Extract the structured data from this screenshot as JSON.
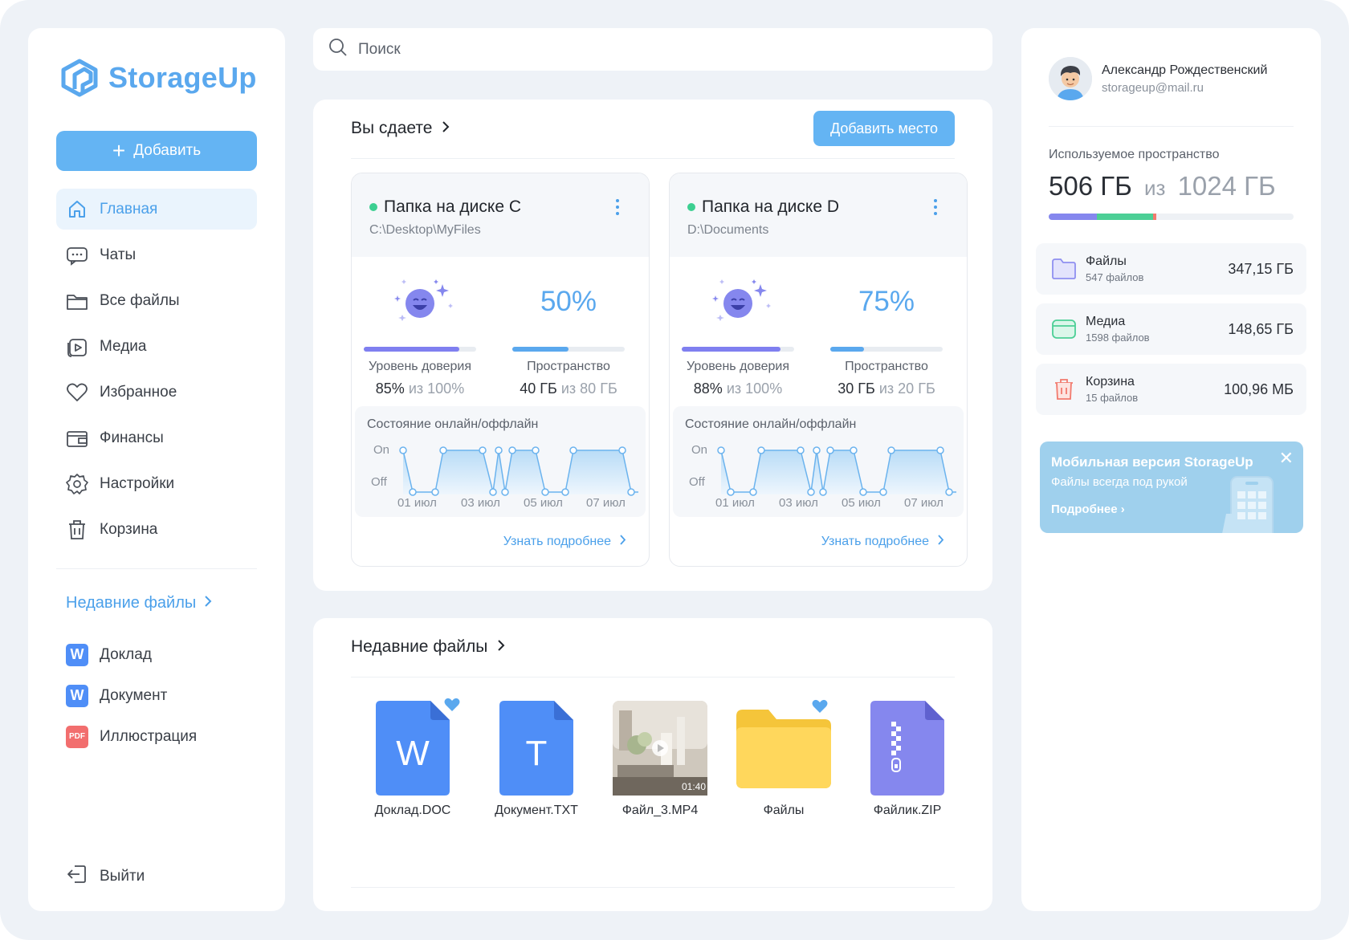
{
  "app": {
    "name": "StorageUp"
  },
  "sidebar": {
    "add_label": "Добавить",
    "items": [
      {
        "label": "Главная",
        "icon": "home-icon",
        "active": true
      },
      {
        "label": "Чаты",
        "icon": "chat-icon"
      },
      {
        "label": "Все файлы",
        "icon": "folder-icon"
      },
      {
        "label": "Медиа",
        "icon": "media-icon"
      },
      {
        "label": "Избранное",
        "icon": "heart-icon"
      },
      {
        "label": "Финансы",
        "icon": "wallet-icon"
      },
      {
        "label": "Настройки",
        "icon": "gear-icon"
      },
      {
        "label": "Корзина",
        "icon": "trash-icon"
      }
    ],
    "recent_title": "Недавние файлы",
    "recent": [
      {
        "badge": "W",
        "label": "Доклад"
      },
      {
        "badge": "W",
        "label": "Документ"
      },
      {
        "badge": "PDF",
        "label": "Иллюстрация"
      }
    ],
    "logout_label": "Выйти"
  },
  "search": {
    "placeholder": "Поиск"
  },
  "rent": {
    "title": "Вы сдаете",
    "add_space_label": "Добавить место",
    "cards": [
      {
        "title": "Папка на диске C",
        "path": "C:\\Desktop\\MyFiles",
        "trust_label": "Уровень доверия",
        "trust_value": "85%",
        "trust_total": "100%",
        "trust_fill": 0.85,
        "space_percent": "50%",
        "space_fill": 0.5,
        "space_label": "Пространство",
        "space_value": "40 ГБ",
        "space_total": "80 ГБ",
        "of": "из",
        "status_title": "Состояние онлайн/оффлайн",
        "y_labels": [
          "On",
          "Off"
        ],
        "x_labels": [
          "01 июл",
          "03 июл",
          "05 июл",
          "07 июл"
        ],
        "more_label": "Узнать подробнее"
      },
      {
        "title": "Папка на диске D",
        "path": "D:\\Documents",
        "trust_label": "Уровень доверия",
        "trust_value": "88%",
        "trust_total": "100%",
        "trust_fill": 0.88,
        "space_percent": "75%",
        "space_fill": 0.3,
        "space_label": "Пространство",
        "space_value": "30 ГБ",
        "space_total": "20 ГБ",
        "of": "из",
        "status_title": "Состояние онлайн/оффлайн",
        "y_labels": [
          "On",
          "Off"
        ],
        "x_labels": [
          "01 июл",
          "03 июл",
          "05 июл",
          "07 июл"
        ],
        "more_label": "Узнать подробнее"
      }
    ]
  },
  "recent_files": {
    "title": "Недавние файлы",
    "files": [
      {
        "name": "Доклад.DOC",
        "letter": "W",
        "favorite": true
      },
      {
        "name": "Документ.TXT",
        "letter": "T",
        "favorite": false
      },
      {
        "name": "Файл_3.MP4",
        "duration": "01:40",
        "favorite": false
      },
      {
        "name": "Файлы",
        "favorite": true
      },
      {
        "name": "Файлик.ZIP",
        "favorite": false
      }
    ]
  },
  "profile": {
    "name": "Александр Рождественский",
    "email": "storageup@mail.ru",
    "used_label": "Используемое пространство",
    "used": "506 ГБ",
    "of": "из",
    "total": "1024 ГБ",
    "stats": [
      {
        "name": "Файлы",
        "count": "547 файлов",
        "size": "347,15 ГБ",
        "icon": "folder-icon",
        "color": "#8f8ff0"
      },
      {
        "name": "Медиа",
        "count": "1598 файлов",
        "size": "148,65 ГБ",
        "icon": "media-icon",
        "color": "#4ccf96"
      },
      {
        "name": "Корзина",
        "count": "15 файлов",
        "size": "100,96 МБ",
        "icon": "trash-icon",
        "color": "#f27a6e"
      }
    ]
  },
  "promo": {
    "title": "Мобильная версия StorageUp",
    "subtitle": "Файлы всегда под рукой",
    "link": "Подробнее"
  },
  "colors": {
    "accent": "#64b4f3",
    "link": "#4ba0ea",
    "green": "#3ccf91",
    "purple": "#7f7ff0"
  }
}
